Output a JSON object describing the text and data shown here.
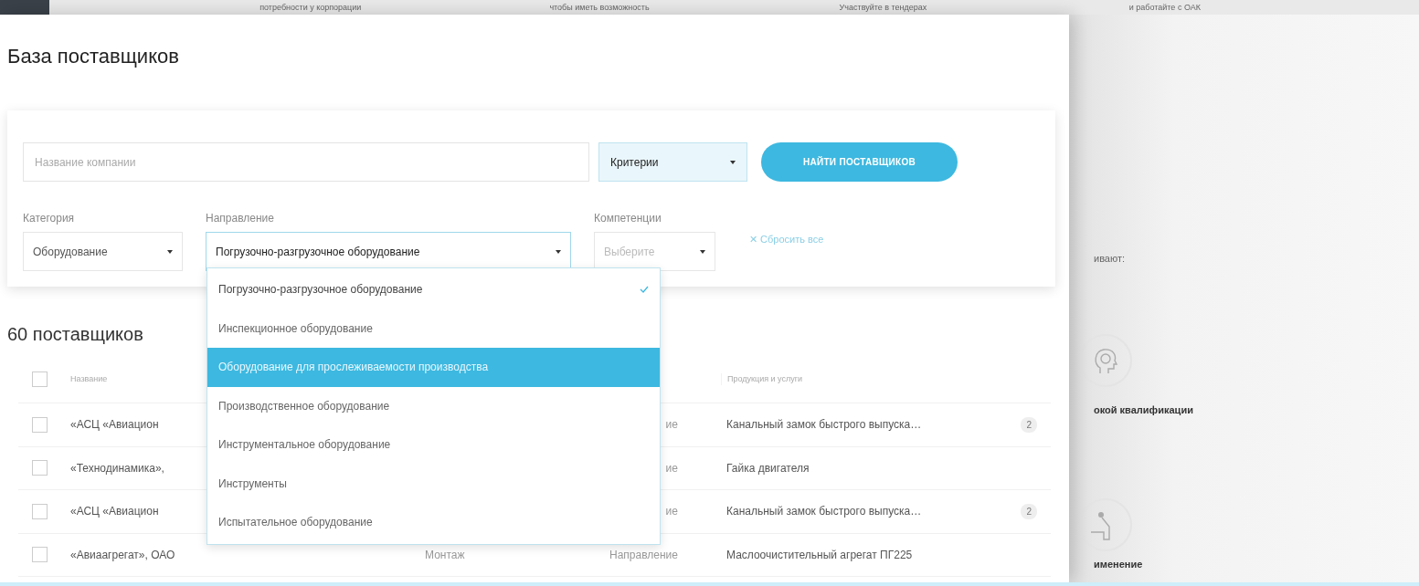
{
  "top_banner": {
    "texts": [
      "потребности у корпорации",
      "чтобы иметь возможность",
      "Участвуйте в тендерах",
      "и работайте с ОАК"
    ]
  },
  "panel": {
    "title": "База поставщиков",
    "search": {
      "placeholder": "Название компании"
    },
    "criteria_select": {
      "value": "Критерии"
    },
    "search_button": "НАЙТИ ПОСТАВЩИКОВ",
    "filters": [
      {
        "label": "Категория",
        "value": "Оборудование",
        "open": false
      },
      {
        "label": "Направление",
        "value": "Погрузочно-разгрузочное оборудование",
        "open": true
      },
      {
        "label": "Компетенции",
        "placeholder": "Выберите",
        "open": false
      }
    ],
    "reset_link": "✕ Сбросить все",
    "dropdown": {
      "options": [
        {
          "label": "Погрузочно-разгрузочное оборудование",
          "selected": true,
          "highlighted": false
        },
        {
          "label": "Инспекционное оборудование",
          "selected": false,
          "highlighted": false
        },
        {
          "label": "Оборудование для прослеживаемости производства",
          "selected": false,
          "highlighted": true
        },
        {
          "label": "Производственное оборудование",
          "selected": false,
          "highlighted": false
        },
        {
          "label": "Инструментальное оборудование",
          "selected": false,
          "highlighted": false
        },
        {
          "label": "Инструменты",
          "selected": false,
          "highlighted": false
        },
        {
          "label": "Испытательное оборудование",
          "selected": false,
          "highlighted": false
        }
      ]
    },
    "results_count": "60 поставщиков",
    "table": {
      "header": {
        "checked": false,
        "name": "Название",
        "products": "Продукция и услуги"
      },
      "rows": [
        {
          "checked": false,
          "name": "«АСЦ «Авиацион",
          "column_3": "ие",
          "products": "Канальный замок быстрого выпуска…",
          "count": "2"
        },
        {
          "checked": false,
          "name": "«Технодинамика»,",
          "column_3": "ие",
          "products": "Гайка двигателя"
        },
        {
          "checked": false,
          "name": "«АСЦ «Авиацион",
          "column_3": "ие",
          "products": "Канальный замок быстрого выпуска…",
          "count": "2"
        },
        {
          "checked": false,
          "name": "«Авиаагрегат», ОАО",
          "column_2": "Монтаж",
          "column_3": "Направление",
          "products": "Маслоочистительный агрегат ПГ225"
        }
      ]
    }
  },
  "background": {
    "intro": "ивают:",
    "features": [
      {
        "title": "окой квалификации"
      },
      {
        "title": "именение"
      }
    ]
  }
}
